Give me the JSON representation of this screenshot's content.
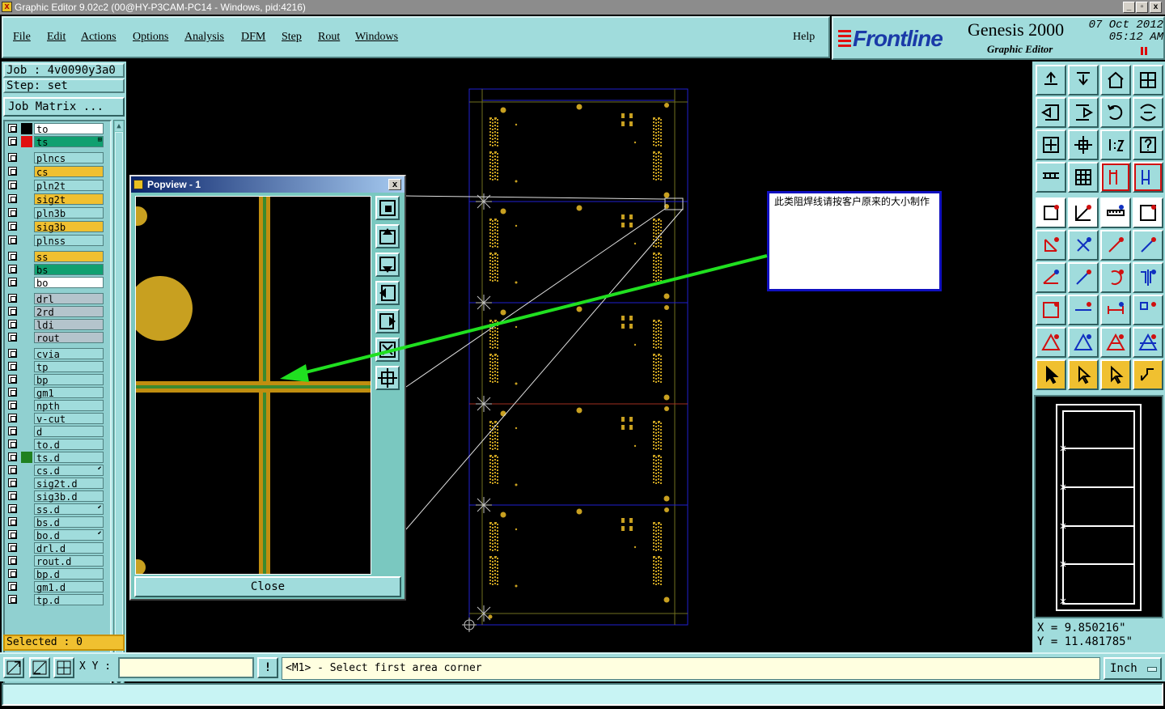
{
  "window": {
    "title": "Graphic Editor 9.02c2 (00@HY-P3CAM-PC14 - Windows, pid:4216)",
    "controls": [
      "_",
      "▫",
      "x"
    ]
  },
  "menu": {
    "items": [
      {
        "label": "File"
      },
      {
        "label": "Edit"
      },
      {
        "label": "Actions"
      },
      {
        "label": "Options"
      },
      {
        "label": "Analysis"
      },
      {
        "label": "DFM"
      },
      {
        "label": "Step"
      },
      {
        "label": "Rout"
      },
      {
        "label": "Windows"
      }
    ],
    "help": "Help"
  },
  "brand": {
    "logo": "Frontline",
    "product": "Genesis 2000",
    "subtitle": "Graphic Editor",
    "date": "07 Oct 2012",
    "time": "05:12 AM"
  },
  "job": {
    "job_label": "Job : 4v0090y3a0",
    "step_label": "Step: set",
    "matrix_button": "Job Matrix ..."
  },
  "layers": [
    {
      "name": "to",
      "color": "#ffffff",
      "swatch": "#000000"
    },
    {
      "name": "ts",
      "color": "#10a070",
      "swatch": "#e01010",
      "active": true,
      "mark": "⊞"
    },
    {
      "name": "plncs",
      "color": "#a0dcdc"
    },
    {
      "name": "cs",
      "color": "#f0c030"
    },
    {
      "name": "pln2t",
      "color": "#a0dcdc"
    },
    {
      "name": "sig2t",
      "color": "#f0c030"
    },
    {
      "name": "pln3b",
      "color": "#a0dcdc"
    },
    {
      "name": "sig3b",
      "color": "#f0c030"
    },
    {
      "name": "plnss",
      "color": "#a0dcdc"
    },
    {
      "name": "ss",
      "color": "#f0c030"
    },
    {
      "name": "bs",
      "color": "#10a070"
    },
    {
      "name": "bo",
      "color": "#ffffff"
    },
    {
      "name": "drl",
      "color": "#b4c4cc"
    },
    {
      "name": "2rd",
      "color": "#b4c4cc"
    },
    {
      "name": "ldi",
      "color": "#b4c4cc"
    },
    {
      "name": "rout",
      "color": "#b4c4cc"
    },
    {
      "name": "cvia",
      "color": "#a0dcdc"
    },
    {
      "name": "tp",
      "color": "#a0dcdc"
    },
    {
      "name": "bp",
      "color": "#a0dcdc"
    },
    {
      "name": "gm1",
      "color": "#a0dcdc"
    },
    {
      "name": "npth",
      "color": "#a0dcdc"
    },
    {
      "name": "v-cut",
      "color": "#a0dcdc"
    },
    {
      "name": "d",
      "color": "#a0dcdc"
    },
    {
      "name": "to.d",
      "color": "#a0dcdc"
    },
    {
      "name": "ts.d",
      "color": "#a0dcdc",
      "swatch": "#208020"
    },
    {
      "name": "cs.d",
      "color": "#a0dcdc",
      "mark": "⬋"
    },
    {
      "name": "sig2t.d",
      "color": "#a0dcdc"
    },
    {
      "name": "sig3b.d",
      "color": "#a0dcdc"
    },
    {
      "name": "ss.d",
      "color": "#a0dcdc",
      "mark": "⬋"
    },
    {
      "name": "bs.d",
      "color": "#a0dcdc"
    },
    {
      "name": "bo.d",
      "color": "#a0dcdc",
      "mark": "⬋"
    },
    {
      "name": "drl.d",
      "color": "#a0dcdc"
    },
    {
      "name": "rout.d",
      "color": "#a0dcdc"
    },
    {
      "name": "bp.d",
      "color": "#a0dcdc"
    },
    {
      "name": "gm1.d",
      "color": "#a0dcdc"
    },
    {
      "name": "tp.d",
      "color": "#a0dcdc"
    }
  ],
  "selected": "Selected : 0",
  "popview": {
    "title": "Popview - 1",
    "close_x": "x",
    "close_button": "Close"
  },
  "note": {
    "text": "此类阻焊线请按客户原来的大小制作"
  },
  "coords": {
    "x": "X = 9.850216\"",
    "y": "Y = 11.481785\""
  },
  "bottom": {
    "xy_label": "X Y :",
    "xy_value": "",
    "info_button": "!",
    "prompt": "<M1> - Select first area corner",
    "units": "Inch"
  },
  "colors": {
    "panel": "#a0dcdc",
    "board_outline": "#2020d0",
    "copper": "#c8a020",
    "annotation_arrow": "#20e020"
  }
}
